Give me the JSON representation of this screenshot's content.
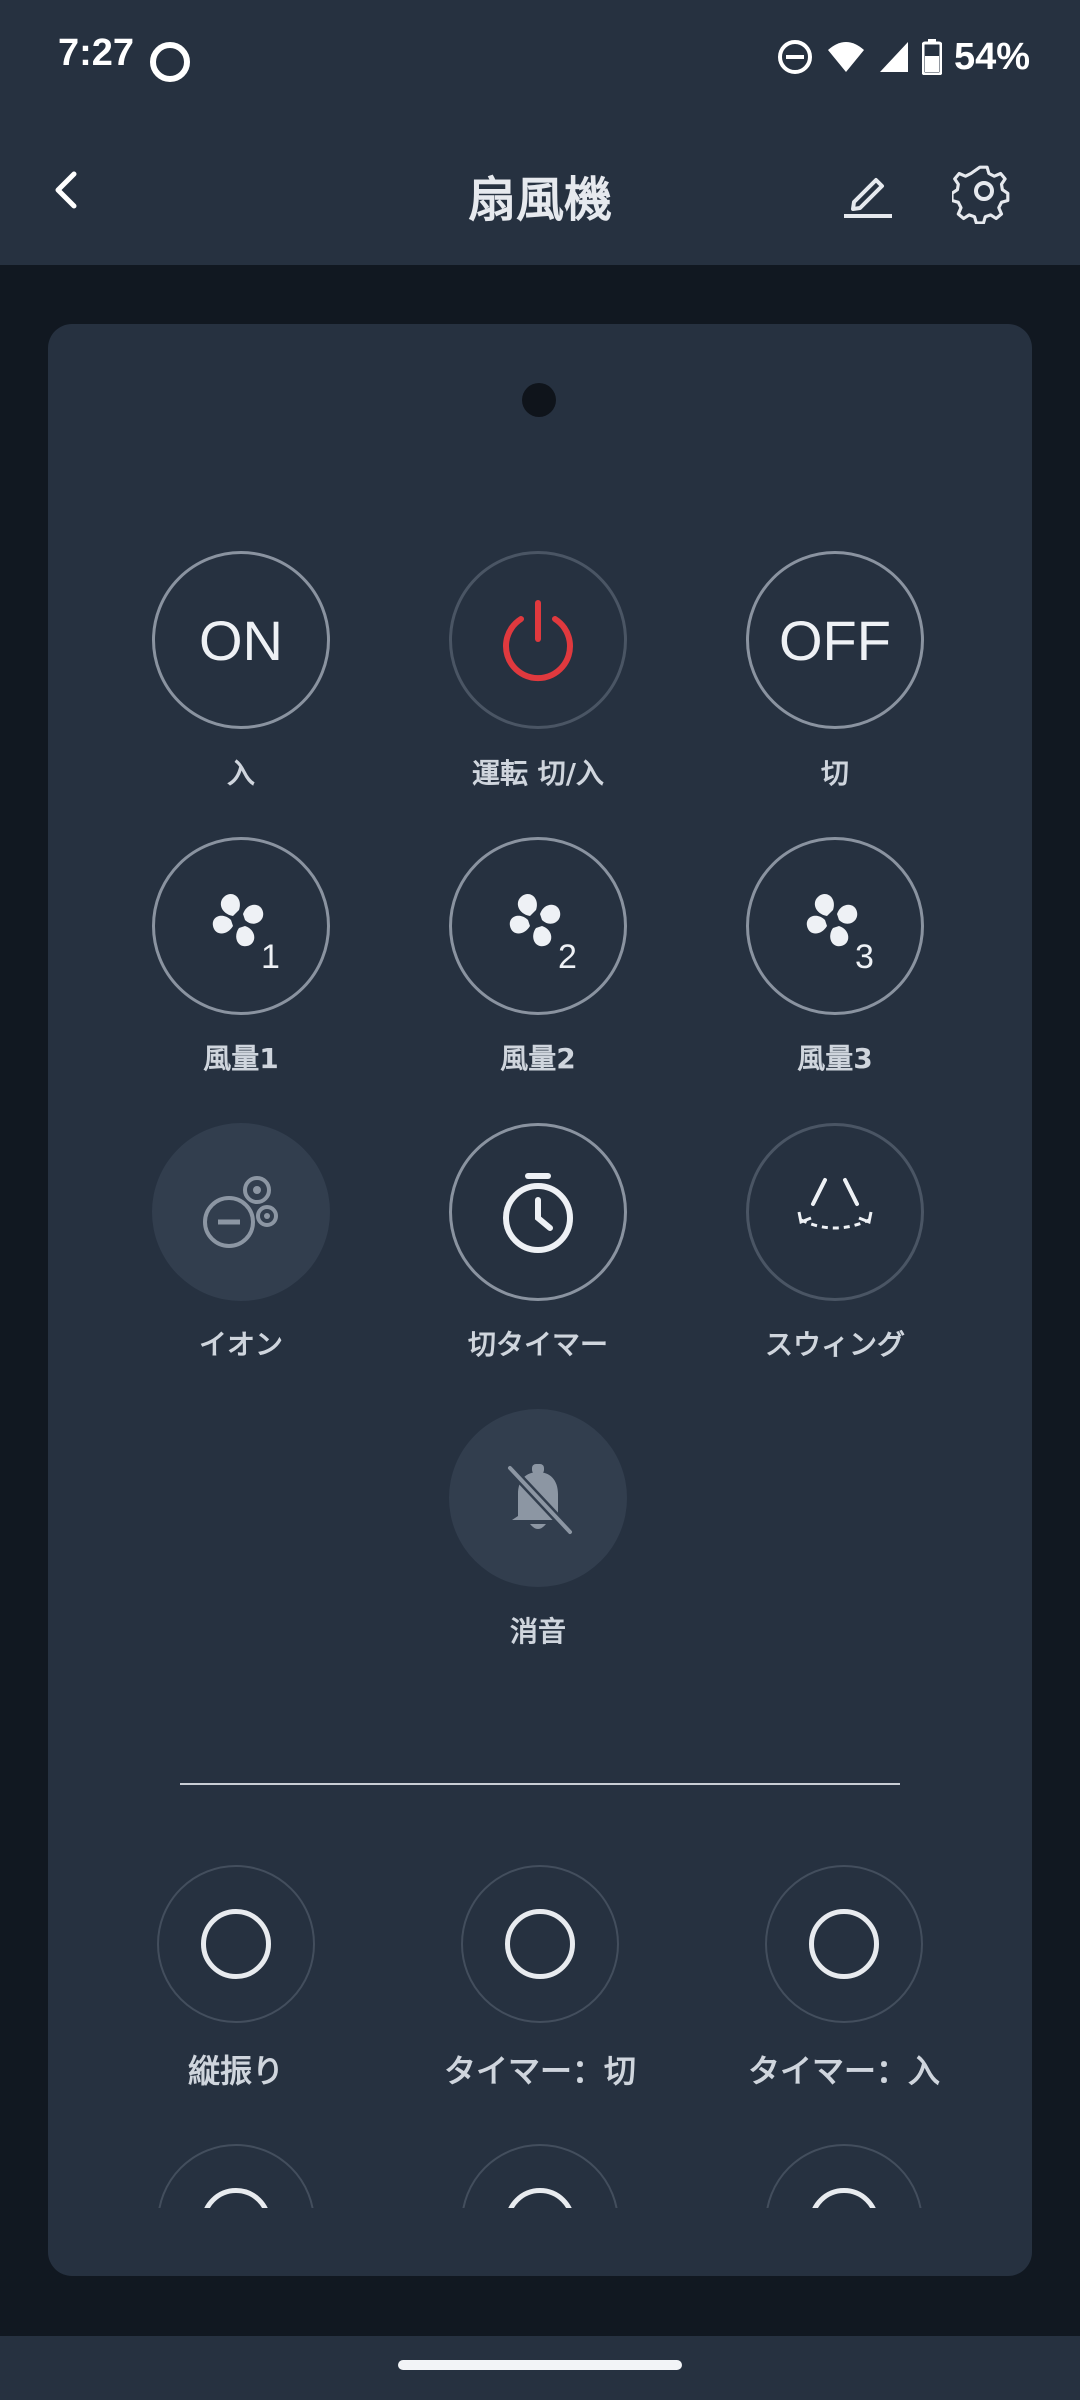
{
  "status": {
    "time": "7:27",
    "battery": "54%",
    "icons": [
      "assistant-ring-icon",
      "do-not-disturb-icon",
      "wifi-icon",
      "cell-signal-icon",
      "battery-icon"
    ]
  },
  "header": {
    "title": "扇風機",
    "back_icon": "chevron-left-icon",
    "edit_icon": "pencil-icon",
    "settings_icon": "gear-icon"
  },
  "remote": {
    "buttons": [
      {
        "label": "入",
        "text": "ON",
        "icon": "on-text-icon"
      },
      {
        "label": "運転 切/入",
        "text": "",
        "icon": "power-icon",
        "accent": "#e0393e"
      },
      {
        "label": "切",
        "text": "OFF",
        "icon": "off-text-icon"
      },
      {
        "label": "風量1",
        "text": "1",
        "icon": "fan-icon"
      },
      {
        "label": "風量2",
        "text": "2",
        "icon": "fan-icon"
      },
      {
        "label": "風量3",
        "text": "3",
        "icon": "fan-icon"
      },
      {
        "label": "イオン",
        "text": "",
        "icon": "ion-icon"
      },
      {
        "label": "切タイマー",
        "text": "",
        "icon": "stopwatch-icon"
      },
      {
        "label": "スウィング",
        "text": "",
        "icon": "swing-icon"
      },
      {
        "label": "消音",
        "text": "",
        "icon": "bell-off-icon"
      }
    ],
    "custom_buttons": [
      {
        "label": "縦振り"
      },
      {
        "label": "タイマー：切"
      },
      {
        "label": "タイマー：入"
      }
    ]
  }
}
